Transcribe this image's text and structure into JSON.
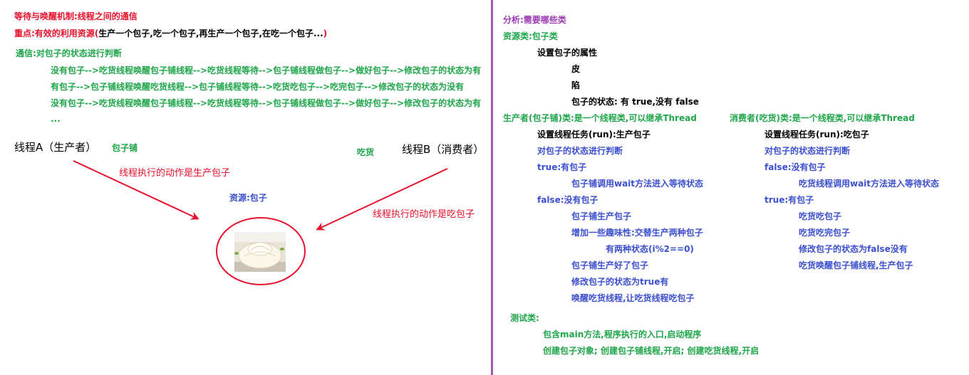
{
  "left": {
    "title": "等待与唤醒机制:线程之间的通信",
    "focus_prefix": "重点:有效的利用资源(",
    "focus_rest": "生产一个包子,吃一个包子,再生产一个包子,在吃一个包子...",
    "focus_end": ")",
    "comm_title": "通信:对包子的状态进行判断",
    "flows": [
      "没有包子-->吃货线程唤醒包子铺线程-->吃货线程等待-->包子铺线程做包子-->做好包子-->修改包子的状态为有",
      "有包子-->包子铺线程唤醒吃货线程-->包子铺线程等待-->吃货吃包子-->吃完包子-->修改包子的状态为没有",
      "没有包子-->吃货线程唤醒包子铺线程-->吃货线程等待-->包子铺线程做包子-->做好包子-->修改包子的状态为有",
      "..."
    ],
    "thread_a": "线程A（生产者）",
    "shop": "包子铺",
    "eater": "吃货",
    "thread_b": "线程B（消费者）",
    "action_a": "线程执行的动作是生产包子",
    "action_b": "线程执行的动作是吃包子",
    "resource": "资源:包子"
  },
  "right": {
    "analysis": "分析:需要哪些类",
    "resource_class": "资源类:包子类",
    "set_attrs": "设置包子的属性",
    "skin": "皮",
    "filling": "陷",
    "state": "包子的状态: 有 true,没有 false",
    "producer_title": "生产者(包子铺)类:是一个线程类,可以继承Thread",
    "producer": [
      "设置线程任务(run):生产包子",
      "对包子的状态进行判断",
      "true:有包子",
      "包子铺调用wait方法进入等待状态",
      "false:没有包子",
      "包子铺生产包子",
      "增加一些趣味性:交替生产两种包子",
      "有两种状态(i%2==0)",
      "包子铺生产好了包子",
      "修改包子的状态为true有",
      "唤醒吃货线程,让吃货线程吃包子"
    ],
    "consumer_title": "消费者(吃货)类:是一个线程类,可以继承Thread",
    "consumer": [
      "设置线程任务(run):吃包子",
      "对包子的状态进行判断",
      "false:没有包子",
      "吃货线程调用wait方法进入等待状态",
      "true:有包子",
      "吃货吃包子",
      "吃货吃完包子",
      "修改包子的状态为false没有",
      "吃货唤醒包子铺线程,生产包子"
    ],
    "test_title": "测试类:",
    "test": [
      "包含main方法,程序执行的入口,启动程序",
      "创建包子对象; 创建包子铺线程,开启; 创建吃货线程,开启"
    ]
  },
  "colors": {
    "red": "#e8112b",
    "green": "#1fa64a",
    "blue": "#3b4fd0",
    "purple": "#9a3cb0",
    "divider": "#a259b5"
  }
}
